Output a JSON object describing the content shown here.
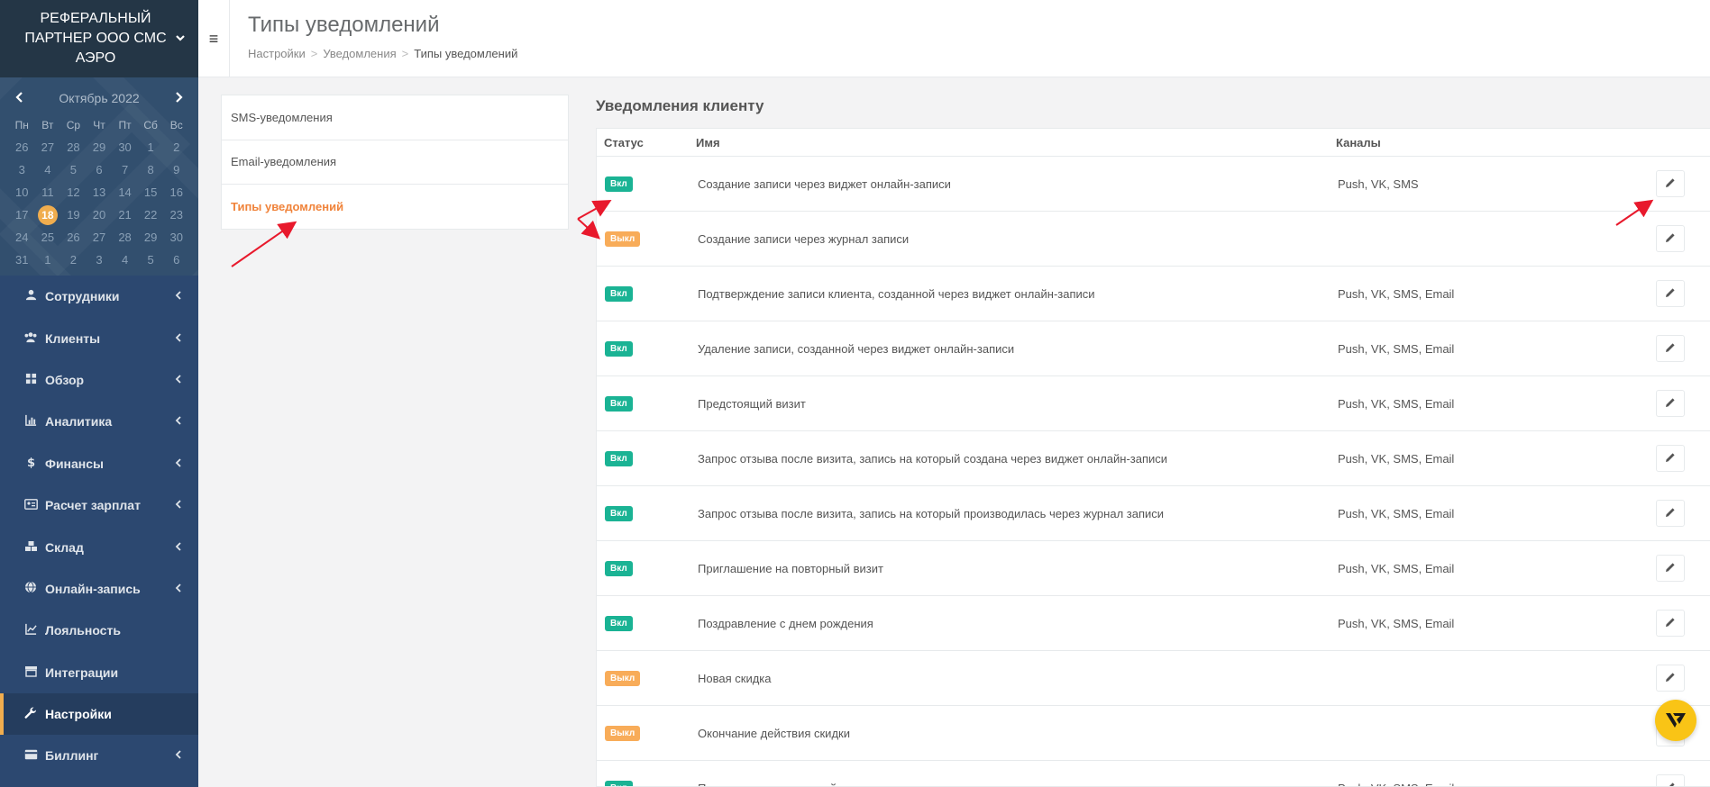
{
  "sidebar": {
    "org_name": "РЕФЕРАЛЬНЫЙ ПАРТНЕР ООО СМС АЭРО",
    "calendar": {
      "month_label": "Октябрь 2022",
      "weekdays": [
        "Пн",
        "Вт",
        "Ср",
        "Чт",
        "Пт",
        "Сб",
        "Вс"
      ],
      "days": [
        "26",
        "27",
        "28",
        "29",
        "30",
        "1",
        "2",
        "3",
        "4",
        "5",
        "6",
        "7",
        "8",
        "9",
        "10",
        "11",
        "12",
        "13",
        "14",
        "15",
        "16",
        "17",
        "18",
        "19",
        "20",
        "21",
        "22",
        "23",
        "24",
        "25",
        "26",
        "27",
        "28",
        "29",
        "30",
        "31",
        "1",
        "2",
        "3",
        "4",
        "5",
        "6"
      ],
      "today": "18"
    },
    "nav": [
      {
        "label": "Сотрудники",
        "icon": "user-icon",
        "chevron": true
      },
      {
        "label": "Клиенты",
        "icon": "users-icon",
        "chevron": true
      },
      {
        "label": "Обзор",
        "icon": "grid-icon",
        "chevron": true
      },
      {
        "label": "Аналитика",
        "icon": "bar-chart-icon",
        "chevron": true
      },
      {
        "label": "Финансы",
        "icon": "dollar-icon",
        "chevron": true
      },
      {
        "label": "Расчет зарплат",
        "icon": "id-card-icon",
        "chevron": true
      },
      {
        "label": "Склад",
        "icon": "boxes-icon",
        "chevron": true
      },
      {
        "label": "Онлайн-запись",
        "icon": "globe-icon",
        "chevron": true
      },
      {
        "label": "Лояльность",
        "icon": "line-chart-icon",
        "chevron": false
      },
      {
        "label": "Интеграции",
        "icon": "store-icon",
        "chevron": false
      },
      {
        "label": "Настройки",
        "icon": "wrench-icon",
        "chevron": false,
        "active": true
      },
      {
        "label": "Биллинг",
        "icon": "credit-card-icon",
        "chevron": true
      }
    ]
  },
  "header": {
    "title": "Типы уведомлений",
    "breadcrumb": [
      "Настройки",
      "Уведомления",
      "Типы уведомлений"
    ]
  },
  "menu": [
    {
      "label": "SMS-уведомления",
      "active": false
    },
    {
      "label": "Email-уведомления",
      "active": false
    },
    {
      "label": "Типы уведомлений",
      "active": true
    }
  ],
  "section": {
    "title": "Уведомления клиенту",
    "columns": {
      "status": "Статус",
      "name": "Имя",
      "channels": "Каналы"
    },
    "rows": [
      {
        "status": "Вкл",
        "on": true,
        "name": "Создание записи через виджет онлайн-записи",
        "channels": "Push, VK, SMS"
      },
      {
        "status": "Выкл",
        "on": false,
        "name": "Создание записи через журнал записи",
        "channels": ""
      },
      {
        "status": "Вкл",
        "on": true,
        "name": "Подтверждение записи клиента, созданной через виджет онлайн-записи",
        "channels": "Push, VK, SMS, Email"
      },
      {
        "status": "Вкл",
        "on": true,
        "name": "Удаление записи, созданной через виджет онлайн-записи",
        "channels": "Push, VK, SMS, Email"
      },
      {
        "status": "Вкл",
        "on": true,
        "name": "Предстоящий визит",
        "channels": "Push, VK, SMS, Email"
      },
      {
        "status": "Вкл",
        "on": true,
        "name": "Запрос отзыва после визита, запись на который создана через виджет онлайн-записи",
        "channels": "Push, VK, SMS, Email"
      },
      {
        "status": "Вкл",
        "on": true,
        "name": "Запрос отзыва после визита, запись на который производилась через журнал записи",
        "channels": "Push, VK, SMS, Email"
      },
      {
        "status": "Вкл",
        "on": true,
        "name": "Приглашение на повторный визит",
        "channels": "Push, VK, SMS, Email"
      },
      {
        "status": "Вкл",
        "on": true,
        "name": "Поздравление с днем рождения",
        "channels": "Push, VK, SMS, Email"
      },
      {
        "status": "Выкл",
        "on": false,
        "name": "Новая скидка",
        "channels": ""
      },
      {
        "status": "Выкл",
        "on": false,
        "name": "Окончание действия скидки",
        "channels": ""
      },
      {
        "status": "Вкл",
        "on": true,
        "name": "Пополнение электронной карты",
        "channels": "Push, VK, SMS, Email"
      }
    ]
  },
  "colors": {
    "accent": "#f0833a",
    "on": "#1ab394",
    "off": "#f8ac59",
    "sidebar": "#2c4870",
    "annotation": "#e8192c"
  }
}
